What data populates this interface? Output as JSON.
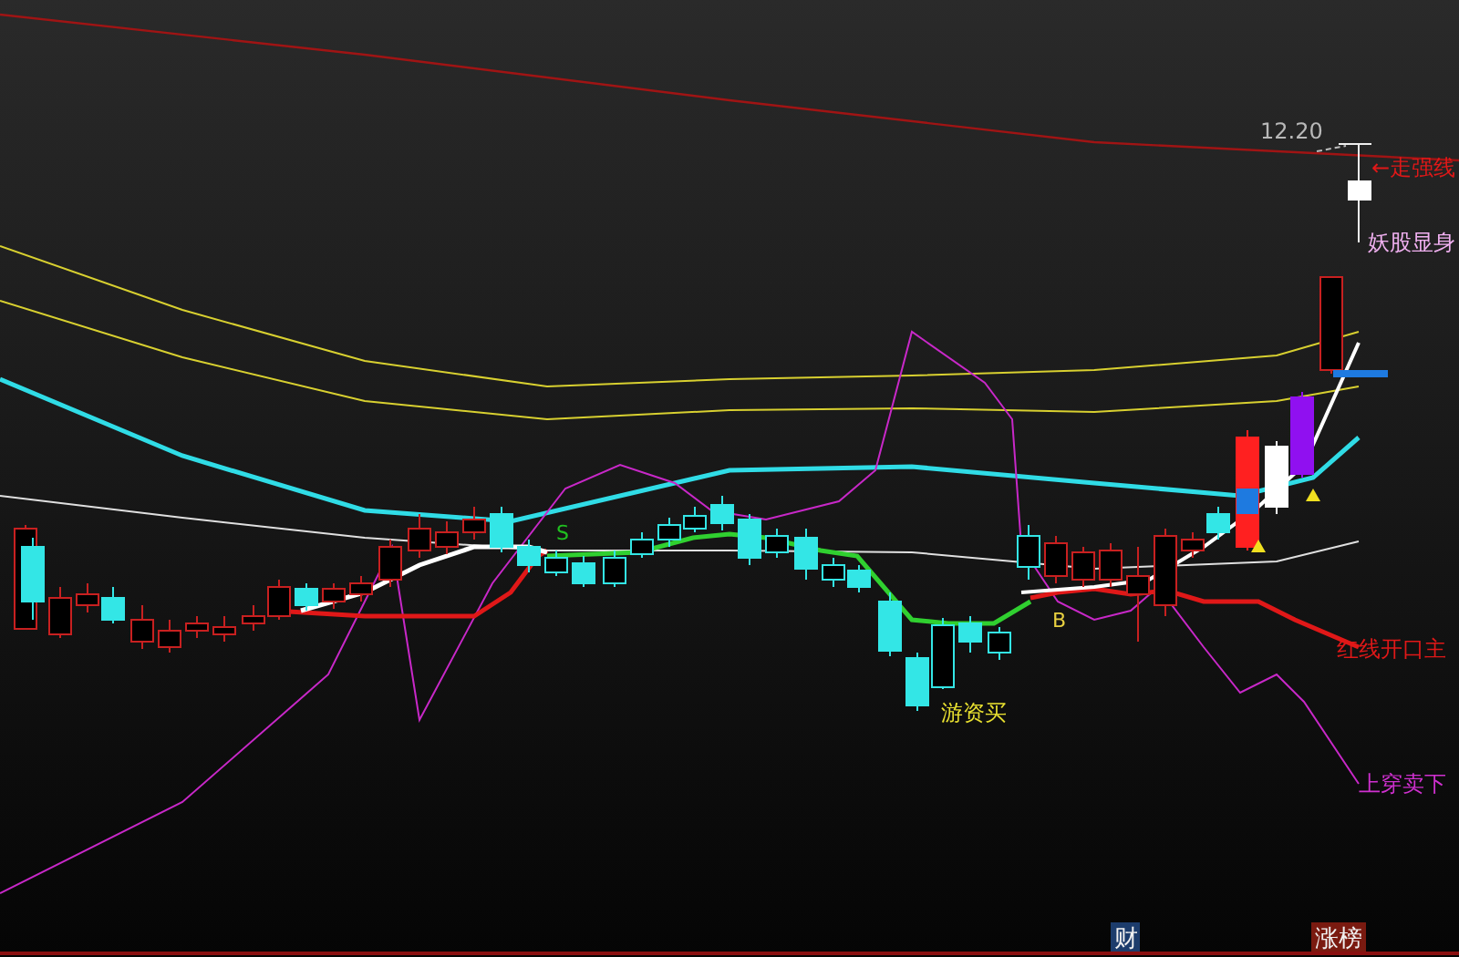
{
  "price_marker": {
    "value": "12.20"
  },
  "annotations": [
    {
      "text": "←走强线",
      "color": "#e01818"
    },
    {
      "text": "妖股显身",
      "color": "#f0b0f0"
    },
    {
      "text": "红线开口主",
      "color": "#e01818"
    },
    {
      "text": "上穿卖下",
      "color": "#d030d0"
    },
    {
      "text": "游资买",
      "color": "#e8e030"
    }
  ],
  "signals": [
    {
      "text": "S",
      "color": "#20c020"
    },
    {
      "text": "B",
      "color": "#e8d040"
    }
  ],
  "footer_tabs": [
    {
      "label": "财",
      "color": "#1c3c6c"
    },
    {
      "label": "涨榜",
      "color": "#7a1a10"
    }
  ]
}
